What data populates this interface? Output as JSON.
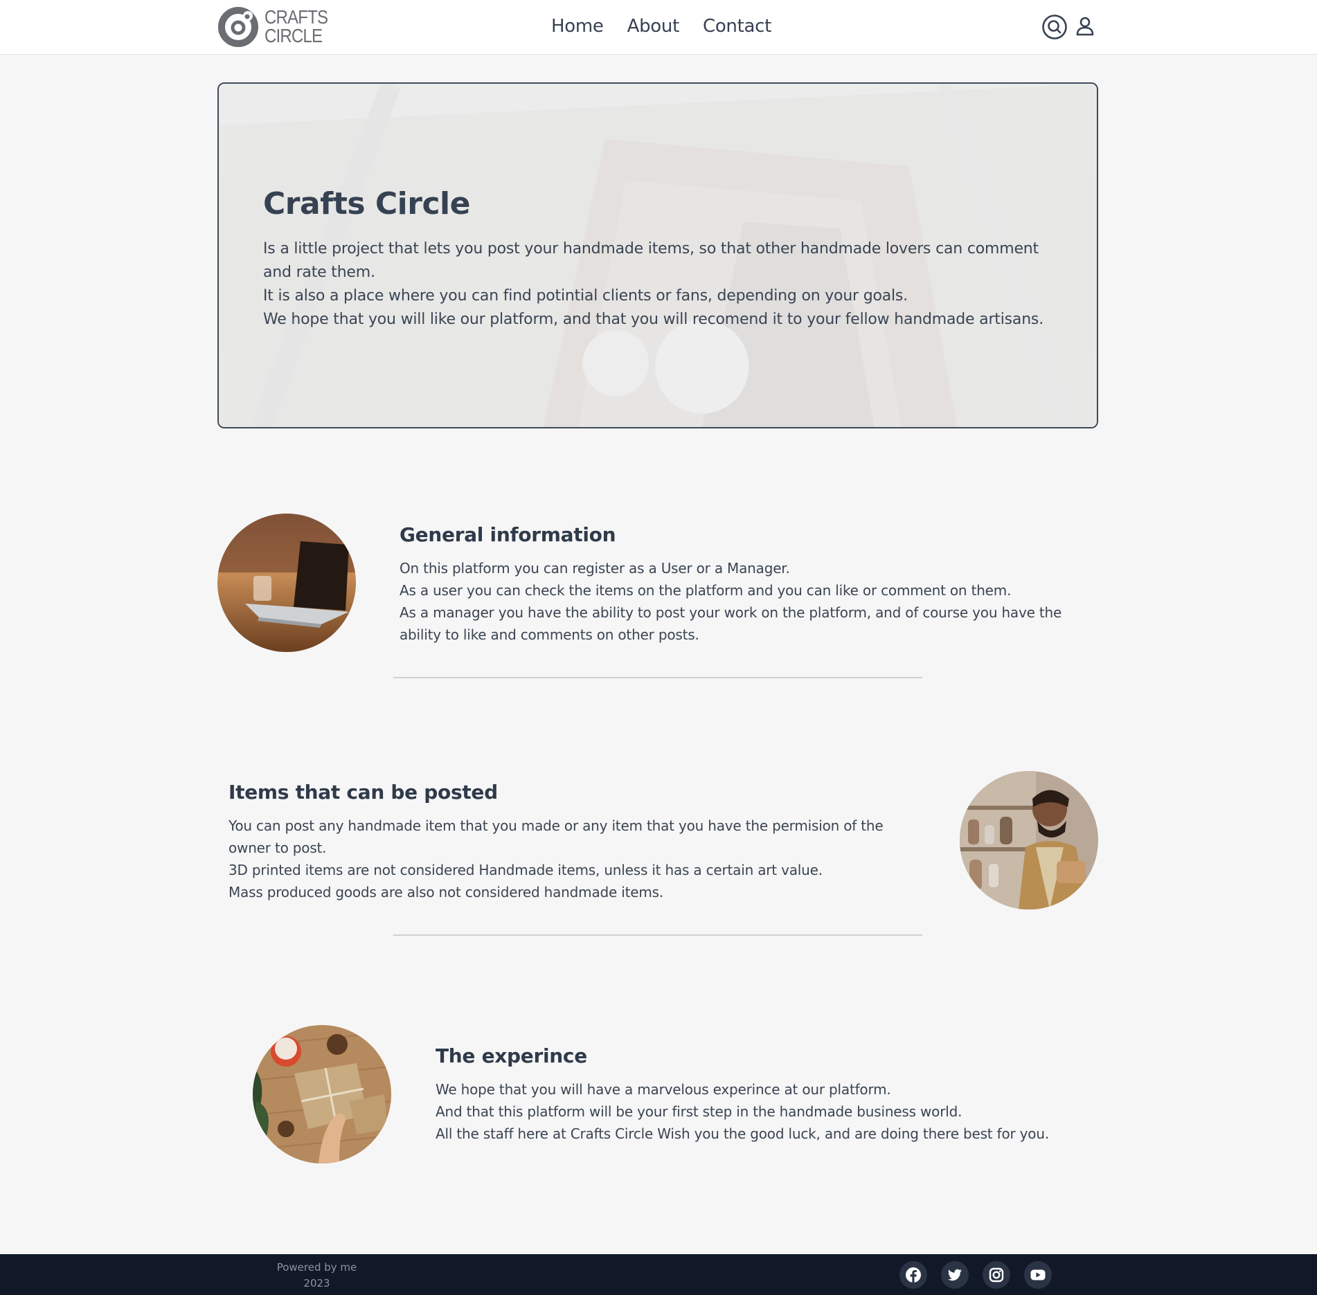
{
  "header": {
    "logo_line1": "CRAFTS",
    "logo_line2": "CIRCLE",
    "nav": [
      "Home",
      "About",
      "Contact"
    ],
    "icons": [
      "search-icon",
      "user-icon"
    ]
  },
  "hero": {
    "title": "Crafts Circle",
    "paragraphs": [
      "Is a little project that lets you post your handmade items, so that other handmade lovers can comment and rate them.",
      "It is also a place where you can find potintial clients or fans, depending on your goals.",
      "We hope that you will like our platform, and that you will recomend it to your fellow handmade artisans."
    ]
  },
  "sections": [
    {
      "title": "General information",
      "paragraphs": [
        "On this platform you can register as a User or a Manager.",
        "As a user you can check the items on the platform and you can like or comment on them.",
        "As a manager you have the ability to post your work on the platform, and of course you have the ability to like and comments on other posts."
      ]
    },
    {
      "title": "Items that can be posted",
      "paragraphs": [
        "You can post any handmade item that you made or any item that you have the permision of the owner to post.",
        "3D printed items are not considered Handmade items, unless it has a certain art value.",
        "Mass produced goods are also not considered handmade items."
      ]
    },
    {
      "title": "The experince",
      "paragraphs": [
        "We hope that you will have a marvelous experince at our platform.",
        "And that this platform will be your first step in the handmade business world.",
        "All the staff here at Crafts Circle Wish you the good luck, and are doing there best for you."
      ]
    }
  ],
  "footer": {
    "powered": "Powered by me",
    "year": "2023",
    "social": [
      "facebook-icon",
      "twitter-icon",
      "instagram-icon",
      "youtube-icon"
    ]
  },
  "colors": {
    "background": "#f6f6f6",
    "text": "#364152",
    "footer": "#111827"
  }
}
